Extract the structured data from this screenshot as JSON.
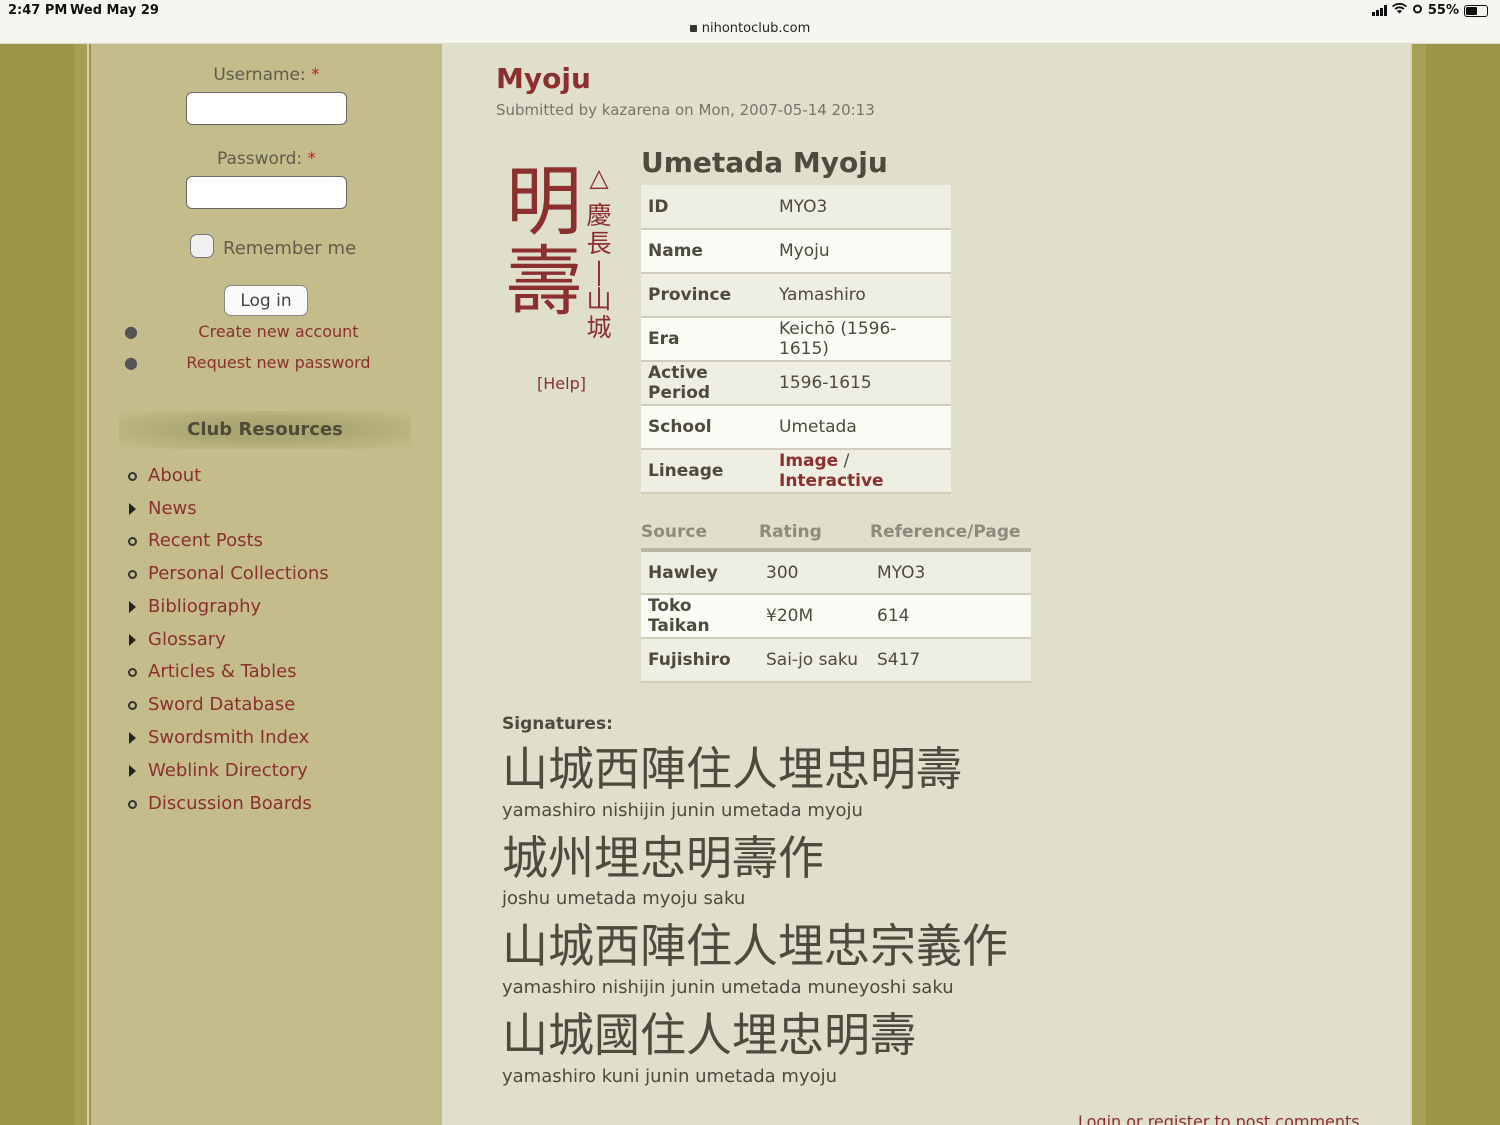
{
  "status_bar": {
    "time": "2:47 PM",
    "date": "Wed May 29",
    "battery": "55%",
    "url": "nihontoclub.com"
  },
  "login": {
    "username_label": "Username:",
    "password_label": "Password:",
    "required_mark": "*",
    "username_value": "",
    "password_value": "",
    "remember_label": "Remember me",
    "login_button": "Log in",
    "create_account": "Create new account",
    "request_password": "Request new password"
  },
  "resources": {
    "title": "Club Resources",
    "items": [
      {
        "label": "About",
        "icon": "circle-bullet"
      },
      {
        "label": "News",
        "icon": "triangle-arrow"
      },
      {
        "label": "Recent Posts",
        "icon": "circle-bullet"
      },
      {
        "label": "Personal Collections",
        "icon": "circle-bullet"
      },
      {
        "label": "Bibliography",
        "icon": "triangle-arrow"
      },
      {
        "label": "Glossary",
        "icon": "triangle-arrow"
      },
      {
        "label": "Articles & Tables",
        "icon": "circle-bullet"
      },
      {
        "label": "Sword Database",
        "icon": "circle-bullet"
      },
      {
        "label": "Swordsmith Index",
        "icon": "triangle-arrow"
      },
      {
        "label": "Weblink Directory",
        "icon": "triangle-arrow"
      },
      {
        "label": "Discussion Boards",
        "icon": "circle-bullet"
      }
    ]
  },
  "page": {
    "title": "Myoju",
    "submitted": "Submitted by kazarena on Mon, 2007-05-14 20:13",
    "kanji_main_1": "明",
    "kanji_main_2": "壽",
    "kanji_side": [
      "△",
      "慶",
      "長",
      "|",
      "山",
      "城"
    ],
    "help": "[Help]",
    "smith_title": "Umetada Myoju"
  },
  "info": {
    "rows": [
      {
        "k": "ID",
        "v": "MYO3"
      },
      {
        "k": "Name",
        "v": "Myoju"
      },
      {
        "k": "Province",
        "v": "Yamashiro"
      },
      {
        "k": "Era",
        "v": "Keichō (1596-1615)"
      },
      {
        "k": "Active Period",
        "v": "1596-1615"
      },
      {
        "k": "School",
        "v": "Umetada"
      }
    ],
    "lineage_label": "Lineage",
    "lineage_image": "Image",
    "lineage_sep": "/",
    "lineage_interactive": "Interactive"
  },
  "sources": {
    "headers": [
      "Source",
      "Rating",
      "Reference/Page"
    ],
    "rows": [
      {
        "source": "Hawley",
        "rating": "300",
        "ref": "MYO3"
      },
      {
        "source": "Toko Taikan",
        "rating": "¥20M",
        "ref": "614"
      },
      {
        "source": "Fujishiro",
        "rating": "Sai-jo saku",
        "ref": "S417"
      }
    ]
  },
  "signatures": {
    "heading": "Signatures:",
    "items": [
      {
        "kanji": "山城西陣住人埋忠明壽",
        "romaji": "yamashiro nishijin junin umetada myoju"
      },
      {
        "kanji": "城州埋忠明壽作",
        "romaji": "joshu umetada myoju saku"
      },
      {
        "kanji": "山城西陣住人埋忠宗義作",
        "romaji": "yamashiro nishijin junin umetada muneyoshi saku"
      },
      {
        "kanji": "山城國住人埋忠明壽",
        "romaji": "yamashiro kuni junin umetada myoju"
      }
    ]
  },
  "comments": {
    "link": "Login or register to post comments"
  },
  "colors": {
    "accent": "#8b2f2f",
    "sidebar": "#c4bd8b",
    "main_bg": "#e0dfcb",
    "outer_bg": "#9c9448"
  }
}
